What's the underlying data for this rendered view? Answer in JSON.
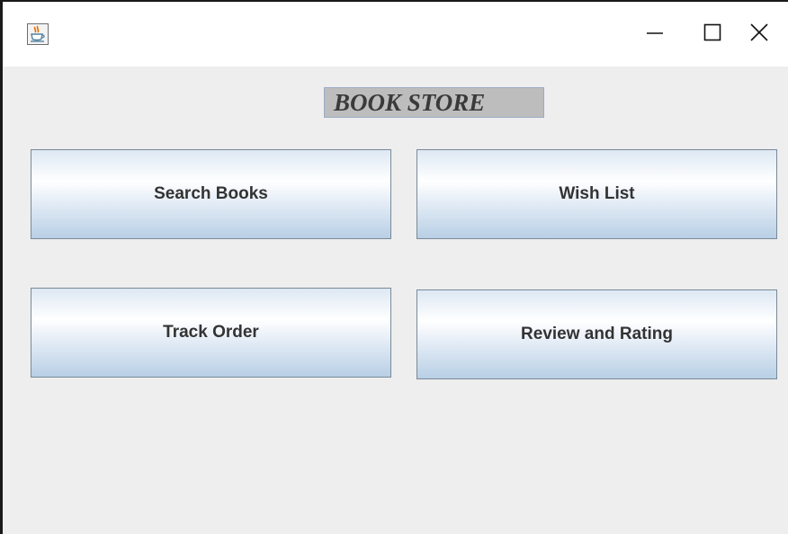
{
  "window": {
    "app_icon": "java-coffee-cup-icon",
    "controls": {
      "minimize_icon": "minimize-icon",
      "maximize_icon": "maximize-icon",
      "close_icon": "close-icon"
    }
  },
  "main": {
    "title": "BOOK STORE",
    "buttons": [
      {
        "label": "Search Books"
      },
      {
        "label": "Wish List"
      },
      {
        "label": "Track Order"
      },
      {
        "label": "Review and Rating"
      }
    ]
  },
  "colors": {
    "content_background": "#eeeeee",
    "title_background": "#bdbdbd",
    "button_gradient_bottom": "#b8cfe5",
    "button_border": "#7a8a99"
  }
}
